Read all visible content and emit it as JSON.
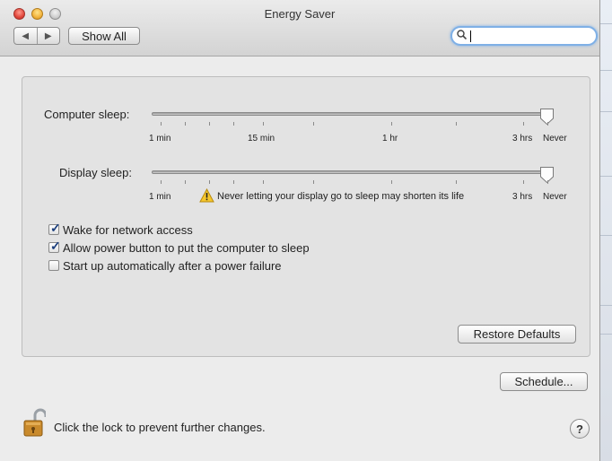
{
  "window": {
    "title": "Energy Saver"
  },
  "toolbar": {
    "back_icon": "◀",
    "forward_icon": "▶",
    "show_all_label": "Show All",
    "search_value": "",
    "search_placeholder": "",
    "search_icon": "magnifier"
  },
  "computer_sleep": {
    "label": "Computer sleep:",
    "ticks": [
      "1 min",
      "15 min",
      "1 hr",
      "3 hrs",
      "Never"
    ],
    "value": "Never"
  },
  "display_sleep": {
    "label": "Display sleep:",
    "ticks": [
      "1 min",
      "3 hrs",
      "Never"
    ],
    "value": "Never",
    "warning_text": "Never letting your display go to sleep may shorten its life"
  },
  "options": [
    {
      "label": "Wake for network access",
      "checked": true
    },
    {
      "label": "Allow power button to put the computer to sleep",
      "checked": true
    },
    {
      "label": "Start up automatically after a power failure",
      "checked": false
    }
  ],
  "buttons": {
    "restore_defaults": "Restore Defaults",
    "schedule": "Schedule..."
  },
  "footer": {
    "lock_text": "Click the lock to prevent further changes.",
    "help_label": "?"
  },
  "colors": {
    "accent": "#7fb0e6",
    "check_mark": "#1c3f7d",
    "lock_gold": "#c98a2c"
  }
}
